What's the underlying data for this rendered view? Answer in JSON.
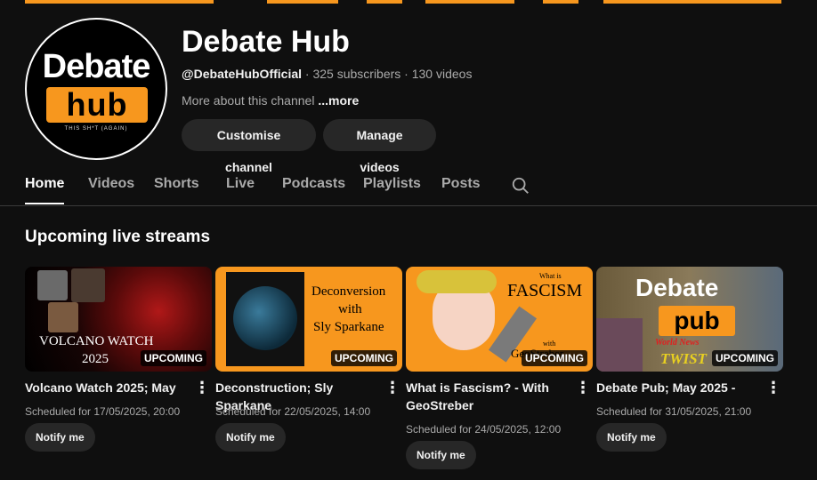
{
  "colors": {
    "accent": "#f7971e",
    "background": "#0f0f0f",
    "pill": "#272727"
  },
  "channel": {
    "avatar_logo_top": "Debate",
    "avatar_logo_hub": "hub",
    "avatar_logo_tag": "THIS SH*T (AGAIN)",
    "name": "Debate Hub",
    "handle": "@DebateHubOfficial",
    "subscribers": " · 325 subscribers",
    "videos": " · 130 videos",
    "about": "More about this channel ",
    "about_more": "...more"
  },
  "buttons": {
    "customise": "Customise channel",
    "manage": "Manage videos"
  },
  "tabs": [
    "Home",
    "Videos",
    "Shorts",
    "Live",
    "Podcasts",
    "Playlists",
    "Posts"
  ],
  "active_tab": "Home",
  "section": {
    "title": "Upcoming live streams"
  },
  "cards": [
    {
      "title": "Volcano Watch 2025; May",
      "thumb_line1": "VOLCANO WATCH",
      "thumb_line2": "2025",
      "badge": "UPCOMING",
      "scheduled": "Scheduled for 17/05/2025, 20:00",
      "notify": "Notify me"
    },
    {
      "title": "Deconstruction; Sly Sparkane",
      "thumb_line1": "Deconversion",
      "thumb_line2": "with",
      "thumb_line3": "Sly Sparkane",
      "badge": "UPCOMING",
      "scheduled": "Scheduled for 22/05/2025, 14:00",
      "notify": "Notify me"
    },
    {
      "title": "What is Fascism? - With GeoStreber",
      "thumb_line1": "What is",
      "thumb_line2": "FASCISM",
      "thumb_line3": "with",
      "thumb_line4": "GeoStreber",
      "badge": "UPCOMING",
      "scheduled": "Scheduled for 24/05/2025, 12:00",
      "notify": "Notify me"
    },
    {
      "title": "Debate Pub; May 2025 -",
      "thumb_line1": "Debate",
      "thumb_line2": "pub",
      "thumb_line3": "World News",
      "thumb_line4": "TWIST",
      "badge": "UPCOMING",
      "scheduled": "Scheduled for 31/05/2025, 21:00",
      "notify": "Notify me"
    }
  ]
}
